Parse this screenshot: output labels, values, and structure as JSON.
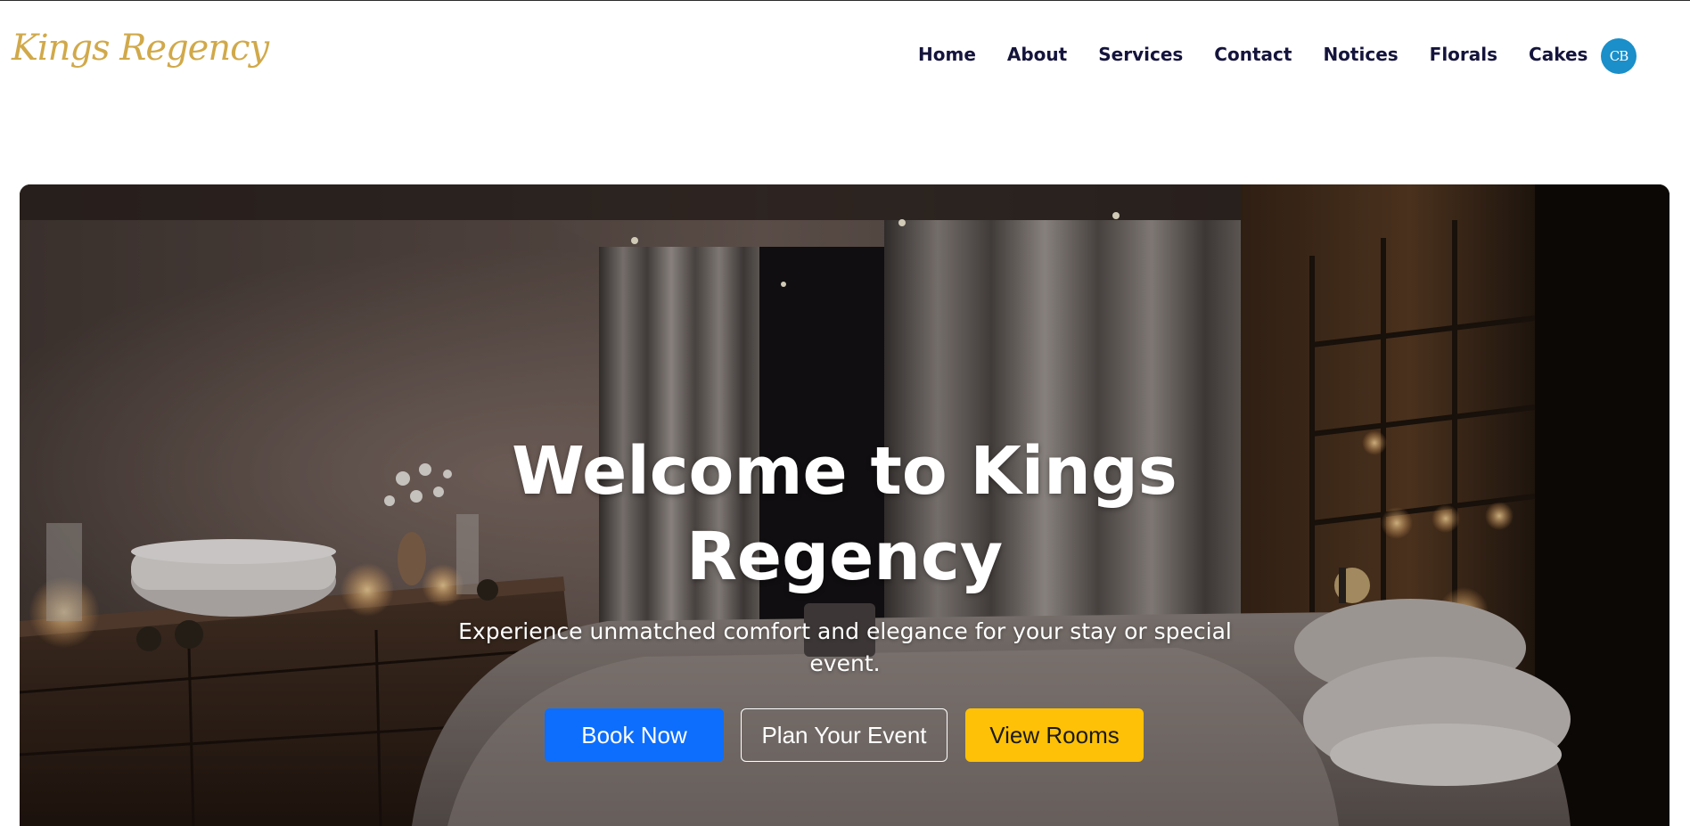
{
  "brand": {
    "logo_text": "Kings Regency",
    "logo_color": "#d1a94a"
  },
  "nav": {
    "links": [
      {
        "label": "Home"
      },
      {
        "label": "About"
      },
      {
        "label": "Services"
      },
      {
        "label": "Contact"
      },
      {
        "label": "Notices"
      },
      {
        "label": "Florals"
      },
      {
        "label": "Cakes"
      }
    ],
    "link_color": "#14143c"
  },
  "user": {
    "avatar_initials": "CB",
    "avatar_color": "#1a8fc9"
  },
  "hero": {
    "title_line1": "Welcome to Kings",
    "title_line2": "Regency",
    "subtitle_line1": "Experience unmatched comfort and elegance for your stay or special",
    "subtitle_line2": "event.",
    "background_image": "dim luxury hotel bedroom with bed, curtains, candles and wooden dresser",
    "buttons": {
      "book_now": "Book Now",
      "plan_event": "Plan Your Event",
      "view_rooms": "View Rooms"
    },
    "colors": {
      "book_now": "#0d6efd",
      "view_rooms": "#ffc107"
    }
  }
}
